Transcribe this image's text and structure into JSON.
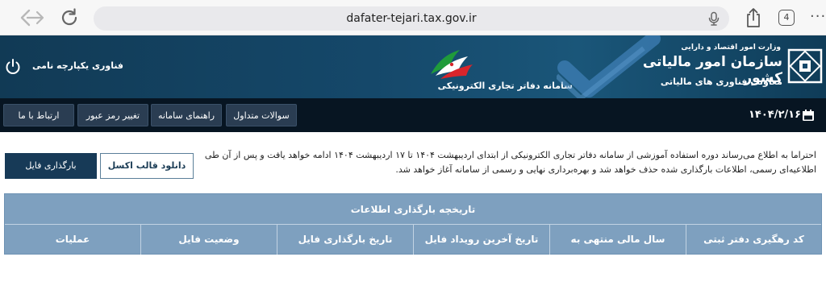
{
  "browser": {
    "url": "dafater-tejari.tax.gov.ir",
    "tab_count": "4",
    "icons": [
      "back-arrow-icon",
      "forward-arrow-icon",
      "reload-icon",
      "microphone-icon",
      "share-icon",
      "tabs-icon",
      "more-icon"
    ]
  },
  "header": {
    "tech_label": "فناوری یکپارچه نامی",
    "system_name": "سامانه دفاتر تجاری الکترونیکی",
    "org_small": "وزارت امور اقتصاد و دارایی",
    "org_title": "سازمان امور مالیاتی کشور",
    "org_dept": "معاونت فناوری های مالیاتی",
    "colors": {
      "banner": "#15486a",
      "nav": "#071522",
      "button": "#2a3d52"
    }
  },
  "nav": {
    "items": [
      {
        "label": "ارتباط با ما"
      },
      {
        "label": "تغییر رمز عبور"
      },
      {
        "label": "راهنمای سامانه"
      },
      {
        "label": "سوالات متداول"
      }
    ],
    "date": "۱۴۰۴/۲/۱۶"
  },
  "notice": {
    "text": "احتراما به اطلاع می‌رساند دوره استفاده آموزشی از سامانه دفاتر تجاری الکترونیکی از ابتدای اردیبهشت ۱۴۰۴ تا ۱۷ اردیبهشت ۱۴۰۴ ادامه خواهد یافت و پس از آن طی اطلاعیه‌ای رسمی، اطلاعات بارگذاری شده حذف خواهد شد و بهره‌برداری نهایی و رسمی از سامانه آغاز خواهد شد."
  },
  "actions": {
    "download_excel": "دانلود قالب اکسل",
    "upload_file": "بارگذاری فایل"
  },
  "history": {
    "title": "تاریخچه بارگذاری اطلاعات",
    "columns": [
      "کد رهگیری دفتر ثبتی",
      "سال مالی منتهی به",
      "تاریخ آخرین رویداد فایل",
      "تاریخ بارگذاری فایل",
      "وضعیت فایل",
      "عملیات"
    ],
    "header_color": "#7ea0bf"
  }
}
